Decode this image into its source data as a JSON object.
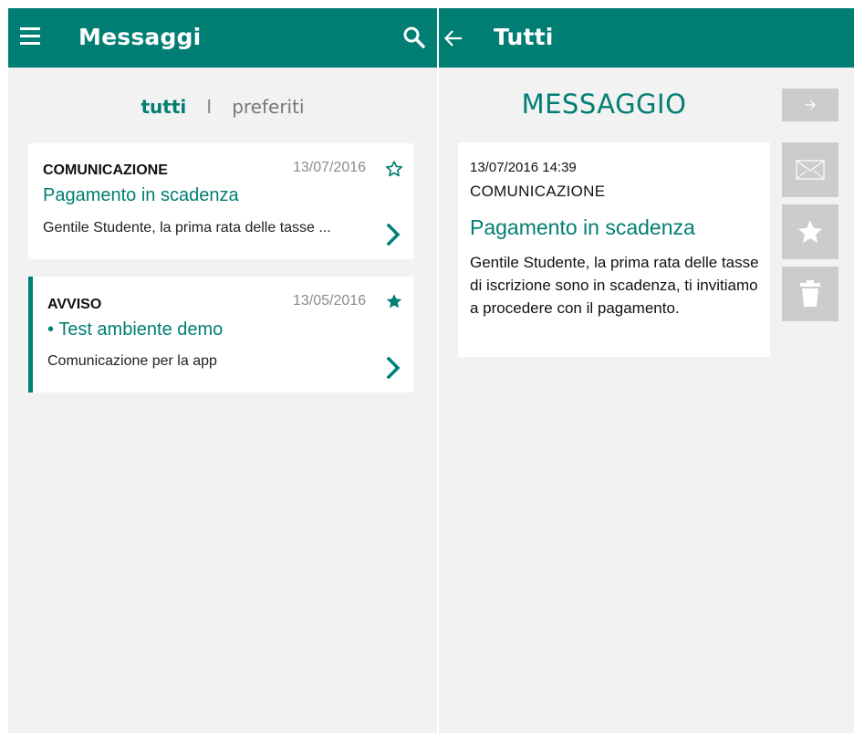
{
  "left": {
    "title": "Messaggi",
    "tabs": {
      "all": "tutti",
      "separator": "I",
      "favorites": "preferiti"
    },
    "messages": [
      {
        "category": "COMUNICAZIONE",
        "date": "13/07/2016",
        "subject": "Pagamento in scadenza",
        "preview": "Gentile Studente, la prima rata delle tasse ...",
        "favorite": false,
        "unread": false
      },
      {
        "category": "AVVISO",
        "date": "13/05/2016",
        "subject": "• Test ambiente demo",
        "preview": "Comunicazione per la app",
        "favorite": true,
        "unread": true
      }
    ]
  },
  "right": {
    "title": "Tutti",
    "heading": "MESSAGGIO",
    "detail": {
      "datetime": "13/07/2016 14:39",
      "category": "COMUNICAZIONE",
      "subject": "Pagamento in scadenza",
      "body": "Gentile Studente, la prima rata delle tasse di iscrizione sono in scadenza, ti invitiamo a procedere con il pagamento."
    }
  },
  "colors": {
    "accent": "#017e74",
    "background": "#f2f2f2",
    "side_button": "#cccccc"
  },
  "icons": [
    "menu-icon",
    "search-icon",
    "back-icon",
    "star-outline-icon",
    "star-filled-icon",
    "chevron-right-icon",
    "arrow-right-icon",
    "mail-icon",
    "star-icon",
    "trash-icon"
  ]
}
